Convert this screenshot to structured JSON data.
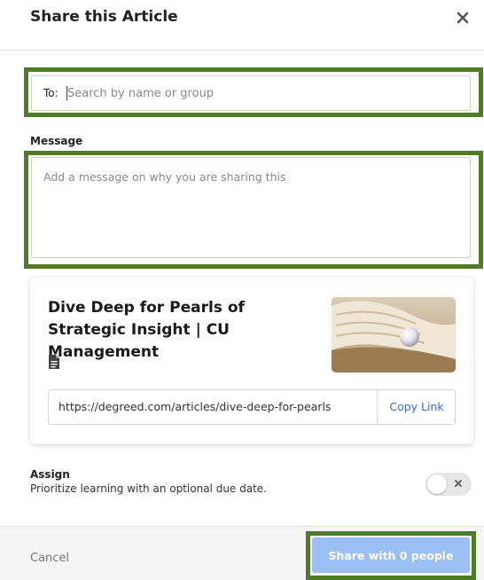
{
  "dialog": {
    "title": "Share this Article"
  },
  "to_field": {
    "label": "To:",
    "value": "",
    "placeholder": "Search by name or group"
  },
  "message": {
    "label": "Message",
    "value": "",
    "placeholder": "Add a message on why you are sharing this"
  },
  "article": {
    "title": "Dive Deep for Pearls of Strategic Insight | CU Management",
    "type_icon": "document-icon",
    "url": "https://degreed.com/articles/dive-deep-for-pearls",
    "copy_label": "Copy Link"
  },
  "assign": {
    "label": "Assign",
    "description": "Prioritize learning with an optional due date.",
    "enabled": false
  },
  "footer": {
    "cancel_label": "Cancel",
    "share_label": "Share with 0 people"
  },
  "colors": {
    "highlight_border": "#4f7a28",
    "share_button_bg": "#9bbff2",
    "link_color": "#2f6fd6"
  }
}
